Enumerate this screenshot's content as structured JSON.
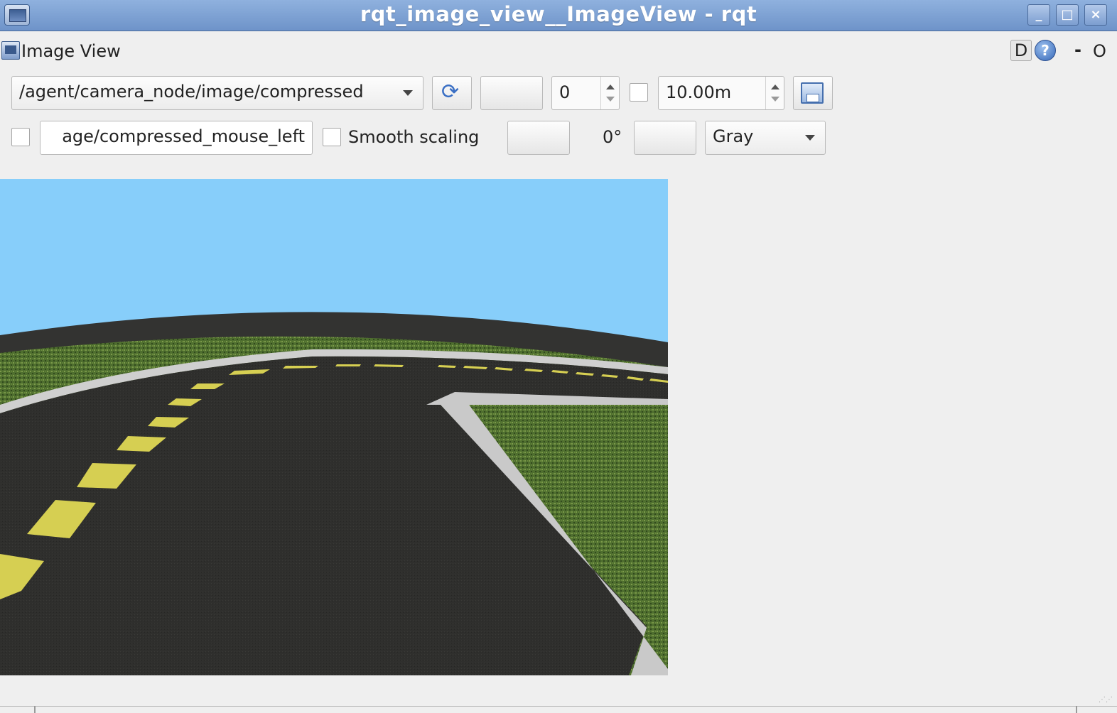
{
  "window": {
    "title": "rqt_image_view__ImageView - rqt",
    "minimize_label": "_",
    "maximize_label": "□",
    "close_label": "×"
  },
  "dock": {
    "title": "Image View",
    "d_label": "D",
    "help_label": "?",
    "minimize_label": "-",
    "close_label": "O"
  },
  "toolbar": {
    "topic": "/agent/camera_node/image/compressed",
    "refresh_icon": "refresh-icon",
    "value_spin": "0",
    "max_range": "10.00m",
    "save_icon": "save-icon",
    "mouse_topic": "age/compressed_mouse_left",
    "smooth_scaling_label": "Smooth scaling",
    "rotation_label": "0°",
    "color_scheme": "Gray"
  },
  "colors": {
    "sky": "#87cefa",
    "asphalt": "#2f2f2d",
    "grass": "#4f6f2f",
    "lane_yellow": "#d8d050",
    "curb": "#c9c9c9",
    "titlebar": "#7a9ad0"
  }
}
